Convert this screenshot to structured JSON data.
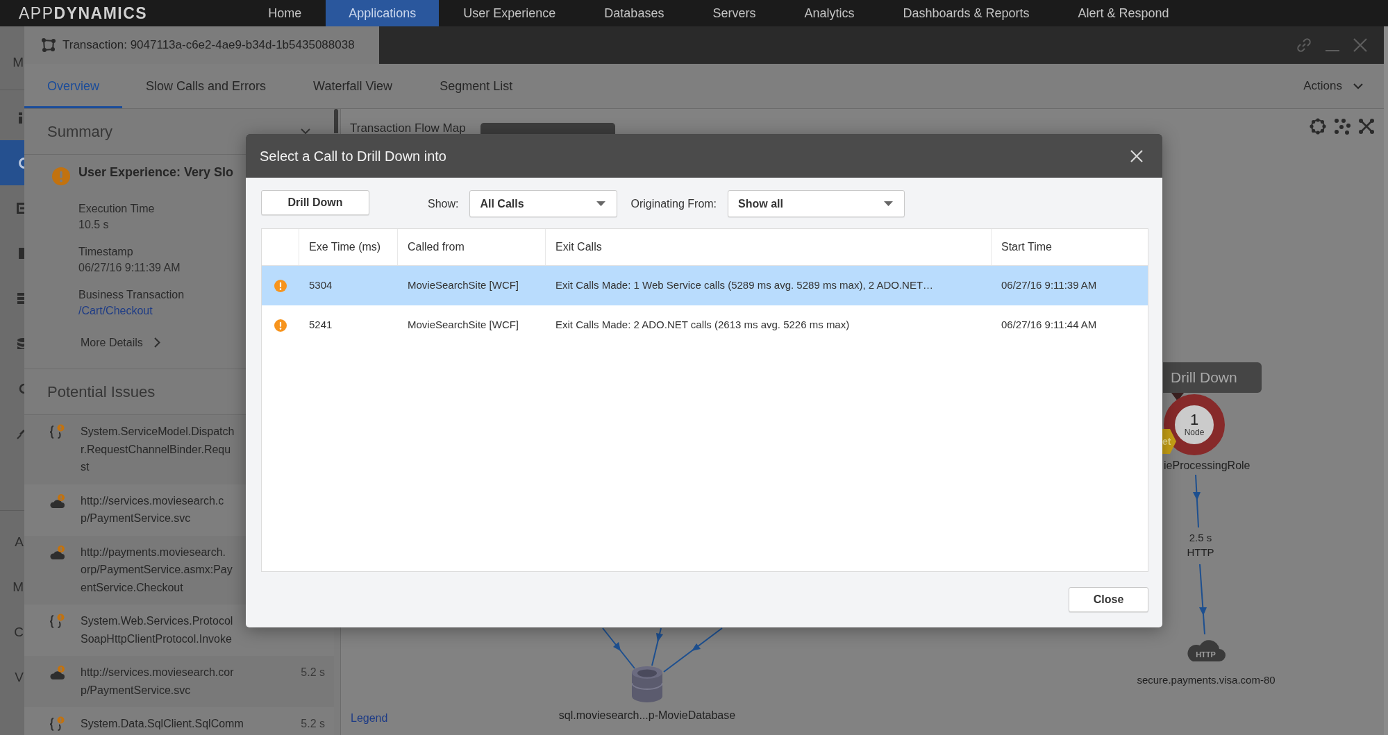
{
  "top_nav": {
    "logo": "APP**DYNAMICS**",
    "items": [
      {
        "label": "Home",
        "selected": false
      },
      {
        "label": "Applications",
        "selected": true
      },
      {
        "label": "User Experience",
        "selected": false
      },
      {
        "label": "Databases",
        "selected": false
      },
      {
        "label": "Servers",
        "selected": false
      },
      {
        "label": "Analytics",
        "selected": false
      },
      {
        "label": "Dashboards & Reports",
        "selected": false
      },
      {
        "label": "Alert & Respond",
        "selected": false
      }
    ]
  },
  "sidebar": {
    "groups": [
      {
        "items": [
          {
            "kind": "label",
            "text": "M",
            "selected": false
          }
        ]
      },
      {
        "items": [
          {
            "kind": "icon",
            "selected": false
          },
          {
            "kind": "icon",
            "selected": true
          },
          {
            "kind": "icon",
            "selected": false
          },
          {
            "kind": "icon",
            "selected": false
          },
          {
            "kind": "icon",
            "selected": false
          },
          {
            "kind": "icon",
            "selected": false
          },
          {
            "kind": "icon",
            "selected": false
          },
          {
            "kind": "icon",
            "selected": false
          }
        ]
      },
      {
        "items": [
          {
            "kind": "label",
            "text": "A",
            "selected": false
          },
          {
            "kind": "label",
            "text": "M",
            "selected": false
          },
          {
            "kind": "label",
            "text": "C",
            "selected": false
          },
          {
            "kind": "label",
            "text": "V",
            "selected": false
          }
        ]
      }
    ]
  },
  "transaction_window": {
    "title": "Transaction: 9047113a-c6e2-4ae9-b34d-1b5435088038",
    "tabs": [
      {
        "label": "Overview",
        "selected": true
      },
      {
        "label": "Slow Calls and Errors",
        "selected": false
      },
      {
        "label": "Waterfall View",
        "selected": false
      },
      {
        "label": "Segment List",
        "selected": false
      }
    ],
    "actions": "Actions"
  },
  "summary": {
    "title": "Summary",
    "issue_title": "User Experience: Very Slo",
    "fields": [
      {
        "kind": "text",
        "label": "Execution Time",
        "value": "10.5 s"
      },
      {
        "kind": "text",
        "label": "Timestamp",
        "value": "06/27/16 9:11:39 AM"
      },
      {
        "kind": "link",
        "label": "Business Transaction",
        "value": "/Cart/Checkout"
      }
    ],
    "more_details": "More Details"
  },
  "potential_issues": {
    "title": "Potential Issues",
    "items": [
      {
        "kind": "code",
        "lines": [
          "System.ServiceModel.Dispatch",
          "r.RequestChannelBinder.Requ",
          "st"
        ]
      },
      {
        "kind": "cloud",
        "lines": [
          "http://services.moviesearch.c",
          "p/PaymentService.svc"
        ]
      },
      {
        "kind": "cloud",
        "lines": [
          "http://payments.moviesearch.",
          "orp/PaymentService.asmx:Pay",
          "entService.Checkout"
        ]
      },
      {
        "kind": "code",
        "lines": [
          "System.Web.Services.Protocol",
          "SoapHttpClientProtocol.Invoke"
        ]
      },
      {
        "kind": "cloud",
        "lines": [
          "http://services.moviesearch.cor",
          "p/PaymentService.svc"
        ],
        "duration": "5.2 s"
      },
      {
        "kind": "code",
        "lines": [
          "System.Data.SqlClient.SqlComm"
        ],
        "duration": "5.2 s"
      }
    ]
  },
  "flow_map": {
    "title": "Transaction Flow Map",
    "drill_down_tooltip": "Drill Down",
    "node": {
      "count": "1",
      "label": "Node",
      "badge": "et",
      "name": "ieProcessingRole"
    },
    "edge": {
      "time": "2.5 s",
      "protocol": "HTTP"
    },
    "http_backend": {
      "badge": "HTTP",
      "label": "secure.payments.visa.com-80"
    },
    "database": {
      "label": "sql.moviesearch...p-MovieDatabase"
    },
    "legend": "Legend"
  },
  "dialog": {
    "title": "Select a Call to Drill Down into",
    "drill_down_button": "Drill Down",
    "show": {
      "label": "Show:",
      "value": "All Calls"
    },
    "originating": {
      "label": "Originating From:",
      "value": "Show all"
    },
    "table": {
      "columns": [
        "Exe Time (ms)",
        "Called from",
        "Exit Calls",
        "Start Time"
      ],
      "rows": [
        {
          "selected": true,
          "cells": [
            "5304",
            "MovieSearchSite [WCF]",
            "Exit Calls Made: 1 Web Service calls (5289 ms avg. 5289 ms max), 2 ADO.NET…",
            "06/27/16 9:11:39 AM"
          ]
        },
        {
          "selected": false,
          "cells": [
            "5241",
            "MovieSearchSite [WCF]",
            "Exit Calls Made: 2 ADO.NET calls (2613 ms avg. 5226 ms max)",
            "06/27/16 9:11:44 AM"
          ]
        }
      ]
    },
    "close_button": "Close"
  }
}
